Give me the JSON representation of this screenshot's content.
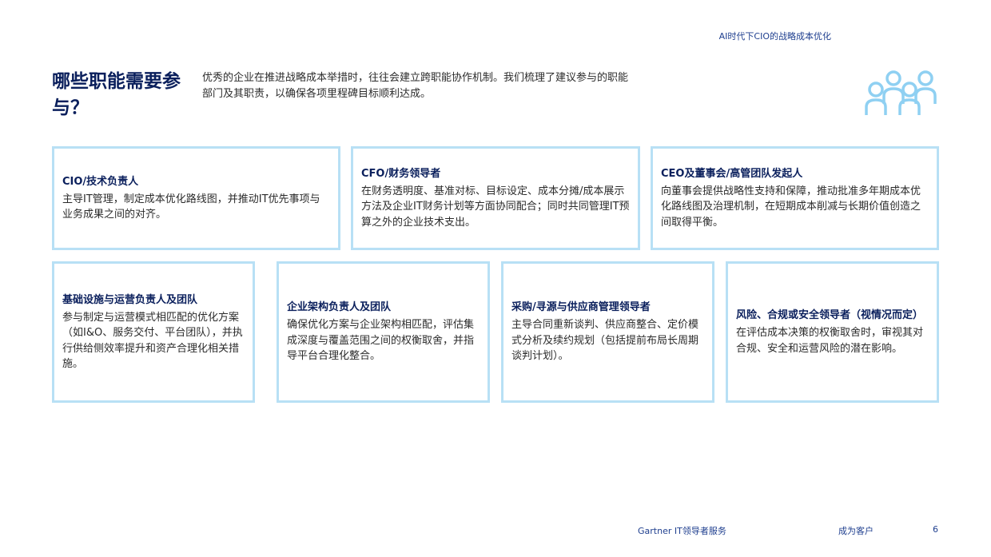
{
  "header": {
    "doc_title": "AI时代下CIO的战略成本优化"
  },
  "main": {
    "title": "哪些职能需要参与？",
    "intro": "优秀的企业在推进战略成本举措时，往往会建立跨职能协作机制。我们梳理了建议参与的职能部门及其职责，以确保各项里程碑目标顺利达成。",
    "icon": "people-group-icon",
    "accent_color": "#b8e0f5",
    "title_color": "#0a1f5c"
  },
  "cards": [
    {
      "title": "CIO/技术负责人",
      "body": "主导IT管理，制定成本优化路线图，并推动IT优先事项与业务成果之间的对齐。"
    },
    {
      "title": "CFO/财务领导者",
      "body": "在财务透明度、基准对标、目标设定、成本分摊/成本展示方法及企业IT财务计划等方面协同配合；同时共同管理IT预算之外的企业技术支出。"
    },
    {
      "title": "CEO及董事会/高管团队发起人",
      "body": "向董事会提供战略性支持和保障，推动批准多年期成本优化路线图及治理机制，在短期成本削减与长期价值创造之间取得平衡。"
    },
    {
      "title": "基础设施与运营负责人及团队",
      "body": "参与制定与运营模式相匹配的优化方案（如I&O、服务交付、平台团队），并执行供给侧效率提升和资产合理化相关措施。"
    },
    {
      "title": "企业架构负责人及团队",
      "body": "确保优化方案与企业架构相匹配，评估集成深度与覆盖范围之间的权衡取舍，并指导平台合理化整合。"
    },
    {
      "title": "采购/寻源与供应商管理领导者",
      "body": "主导合同重新谈判、供应商整合、定价模式分析及续约规划（包括提前布局长周期谈判计划）。"
    },
    {
      "title": "风险、合规或安全领导者（视情况而定）",
      "body": "在评估成本决策的权衡取舍时，审视其对合规、安全和运营风险的潜在影响。"
    }
  ],
  "footer": {
    "brand": "Gartner IT领导者服务",
    "link": "成为客户",
    "page": "6"
  }
}
